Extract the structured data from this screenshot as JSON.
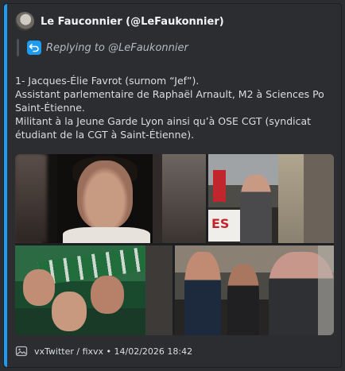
{
  "embed": {
    "accent_color": "#1d9bf0",
    "author": {
      "name": "Le Fauconnier (@LeFaukonnier)"
    },
    "reply": {
      "text": "Replying to @LeFaukonnier",
      "icon": "reply-arrow-icon"
    },
    "description": "1- Jacques-Élie Favrot (surnom “Jef”).\nAssistant parlementaire de Raphaël Arnault, M2 à Sciences Po Saint-Étienne.\nMilitant à la Jeune Garde Lyon ainsi qu’à OSE CGT (syndicat étudiant de la CGT à Saint-Étienne).",
    "media": {
      "images": [
        {
          "name": "photo-portrait"
        },
        {
          "name": "photo-demonstration-banner",
          "visible_text": "ES"
        },
        {
          "name": "photo-football-crowd"
        },
        {
          "name": "photo-street-group"
        }
      ]
    },
    "footer": {
      "text": "vxTwitter / fixvx • 14/02/2026 18:42",
      "icon": "image-icon"
    }
  }
}
